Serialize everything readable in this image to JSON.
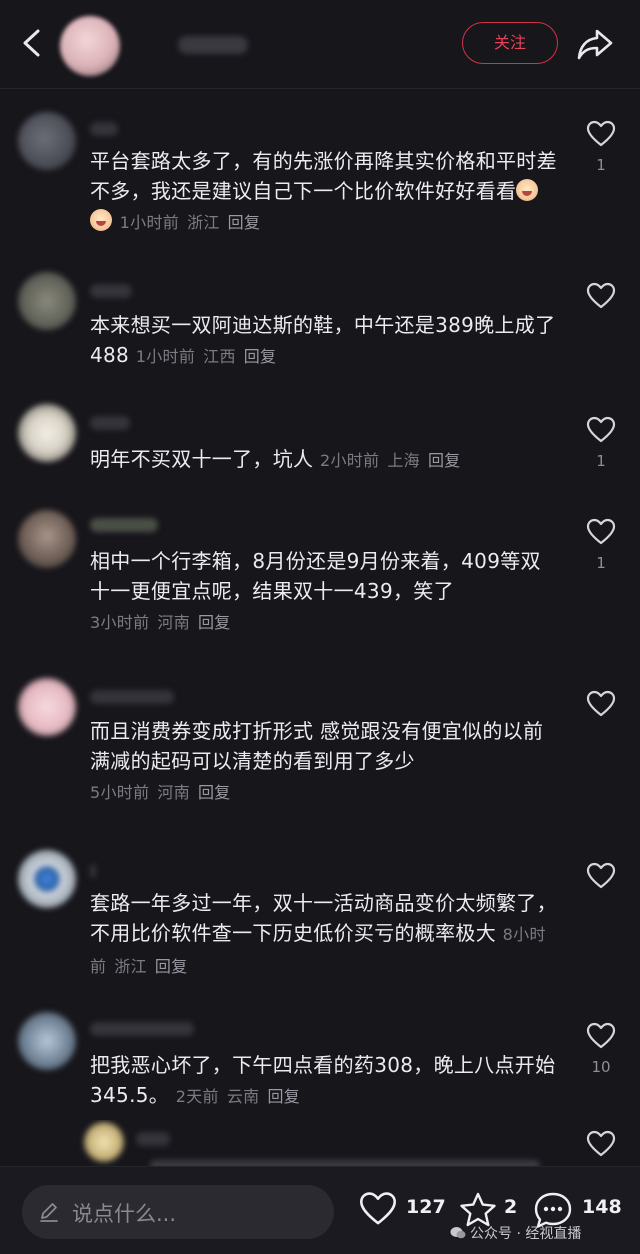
{
  "header": {
    "follow_label": "关注"
  },
  "comments": [
    {
      "text": "平台套路太多了，有的先涨价再降其实价格和平时差不多，我还是建议自己下一个比价软件好好看看",
      "emoji_count": 2,
      "time": "1小时前",
      "location": "浙江",
      "reply_label": "回复",
      "likes": "1"
    },
    {
      "text": "本来想买一双阿迪达斯的鞋，中午还是389晚上成了488",
      "time": "1小时前",
      "location": "江西",
      "reply_label": "回复",
      "likes": ""
    },
    {
      "text": "明年不买双十一了，坑人",
      "time": "2小时前",
      "location": "上海",
      "reply_label": "回复",
      "likes": "1"
    },
    {
      "text": "相中一个行李箱，8月份还是9月份来着，409等双十一更便宜点呢，结果双十一439，笑了",
      "time": "3小时前",
      "location": "河南",
      "reply_label": "回复",
      "likes": "1"
    },
    {
      "text": "而且消费券变成打折形式 感觉跟没有便宜似的以前满减的起码可以清楚的看到用了多少",
      "time": "5小时前",
      "location": "河南",
      "reply_label": "回复",
      "likes": ""
    },
    {
      "text": "套路一年多过一年，双十一活动商品变价太频繁了，不用比价软件查一下历史低价买亏的概率极大",
      "time": "8小时前",
      "location": "浙江",
      "reply_label": "回复",
      "likes": ""
    },
    {
      "text": "把我恶心坏了，下午四点看的药308，晚上八点开始345.5。",
      "time": "2天前",
      "location": "云南",
      "reply_label": "回复",
      "likes": "10"
    }
  ],
  "bottom_bar": {
    "input_placeholder": "说点什么...",
    "like_count": "127",
    "favorite_count": "2",
    "comment_count": "148",
    "watermark": "公众号 · 经视直播"
  },
  "colors": {
    "background": "#17161b",
    "accent": "#e8415a",
    "muted_text": "#7c7b83"
  }
}
